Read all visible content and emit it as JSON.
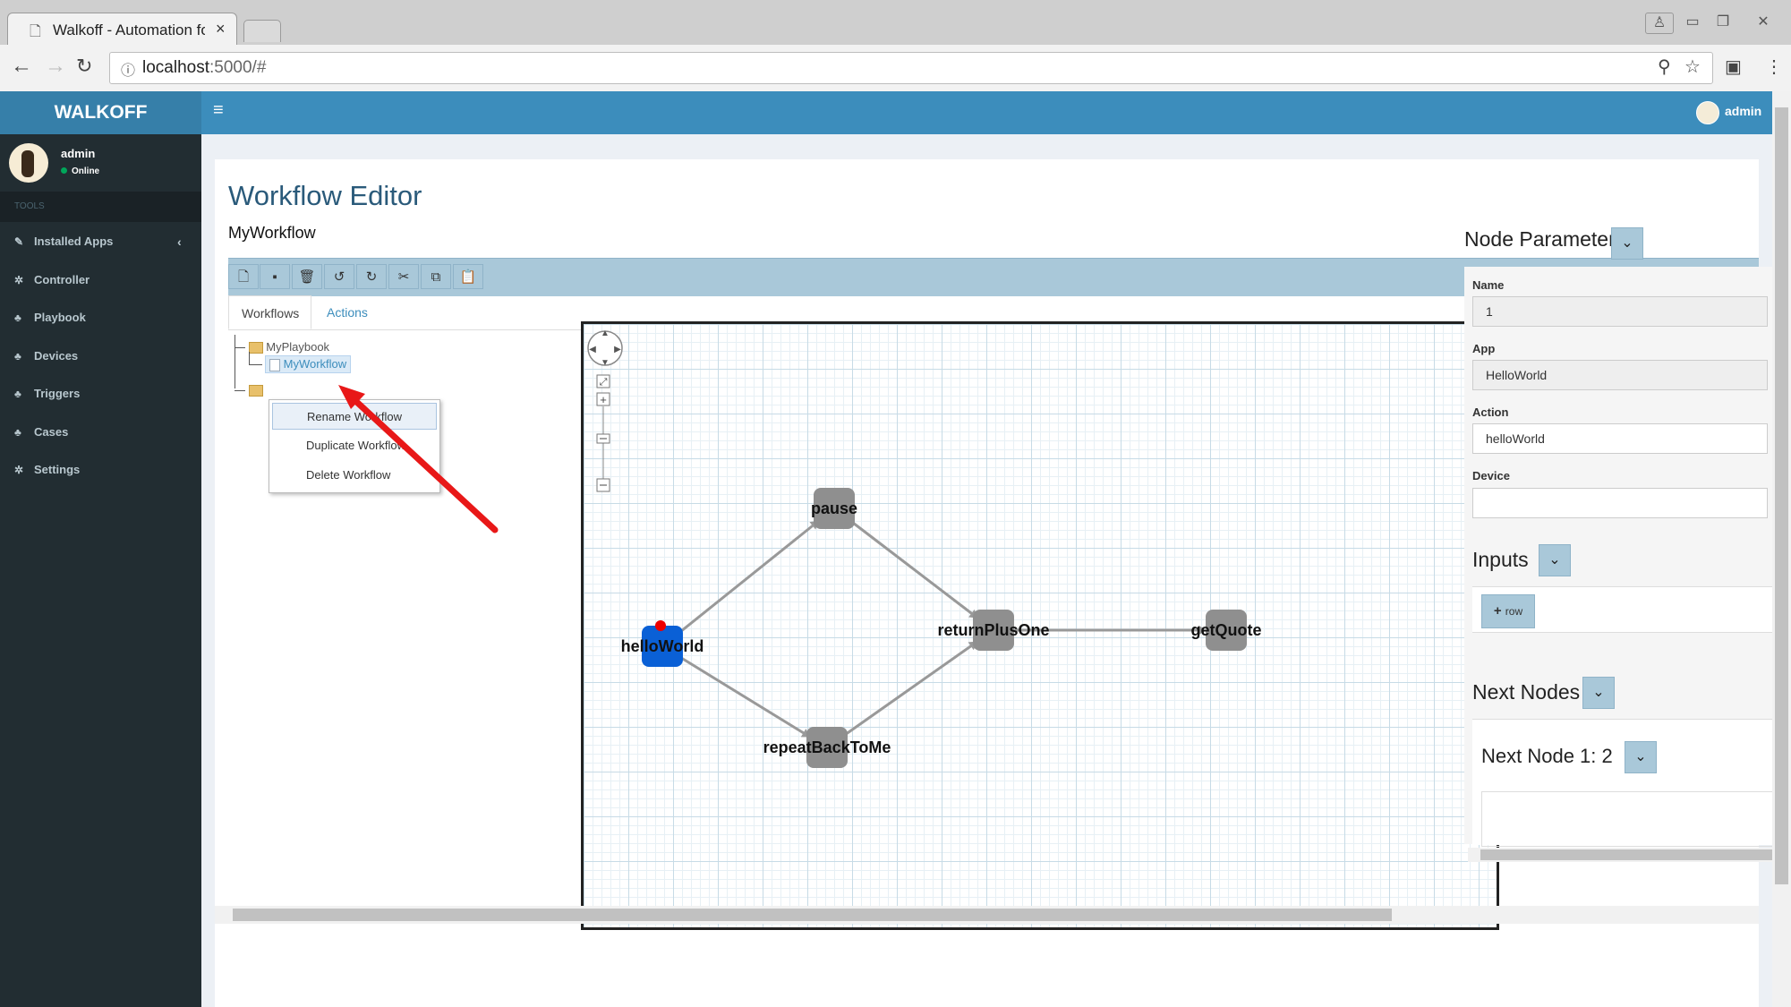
{
  "browser": {
    "tab_title": "Walkoff - Automation for E",
    "tab_close": "×",
    "url_host": "localhost",
    "url_rest": ":5000/#"
  },
  "app": {
    "brand": "WALKOFF",
    "header_user": "admin"
  },
  "sidebar": {
    "user": "admin",
    "status": "Online",
    "section": "TOOLS",
    "items": [
      {
        "label": "Installed Apps",
        "icon": "wrench-icon",
        "glyph": "✎",
        "chevron": "‹"
      },
      {
        "label": "Controller",
        "icon": "gear-icon",
        "glyph": "✲"
      },
      {
        "label": "Playbook",
        "icon": "sitemap-icon",
        "glyph": "♣"
      },
      {
        "label": "Devices",
        "icon": "sitemap-icon",
        "glyph": "♣"
      },
      {
        "label": "Triggers",
        "icon": "sitemap-icon",
        "glyph": "♣"
      },
      {
        "label": "Cases",
        "icon": "sitemap-icon",
        "glyph": "♣"
      },
      {
        "label": "Settings",
        "icon": "gear-icon",
        "glyph": "✲"
      }
    ]
  },
  "editor": {
    "title": "Workflow Editor",
    "workflow_name": "MyWorkflow",
    "tabs": [
      "Workflows",
      "Actions"
    ],
    "tree": {
      "playbook": "MyPlaybook",
      "workflow": "MyWorkflow"
    },
    "context_menu": [
      "Rename Workflow",
      "Duplicate Workflow",
      "Delete Workflow"
    ]
  },
  "graph": {
    "nodes": [
      {
        "id": "helloWorld",
        "label": "helloWorld",
        "color": "#0a60d6",
        "start": true
      },
      {
        "id": "pause",
        "label": "pause",
        "color": "#8f8f8f"
      },
      {
        "id": "repeatBackToMe",
        "label": "repeatBackToMe",
        "color": "#8f8f8f"
      },
      {
        "id": "returnPlusOne",
        "label": "returnPlusOne",
        "color": "#8f8f8f"
      },
      {
        "id": "getQuote",
        "label": "getQuote",
        "color": "#8f8f8f"
      }
    ],
    "edges": [
      [
        "helloWorld",
        "pause"
      ],
      [
        "helloWorld",
        "repeatBackToMe"
      ],
      [
        "pause",
        "returnPlusOne"
      ],
      [
        "repeatBackToMe",
        "returnPlusOne"
      ],
      [
        "returnPlusOne",
        "getQuote"
      ]
    ]
  },
  "node_params": {
    "title": "Node Parameters",
    "fields": [
      {
        "label": "Name",
        "value": "1"
      },
      {
        "label": "App",
        "value": "HelloWorld"
      },
      {
        "label": "Action",
        "value": "helloWorld"
      },
      {
        "label": "Device",
        "value": ""
      }
    ],
    "inputs_title": "Inputs",
    "row_button": "row",
    "next_nodes_title": "Next Nodes",
    "next_node_item": "Next Node 1: 2"
  },
  "colors": {
    "header_blue": "#3c8dbc",
    "sidebar_dark": "#222d32",
    "toolbar": "#a9c8d9",
    "annotation_arrow": "#e81818"
  }
}
